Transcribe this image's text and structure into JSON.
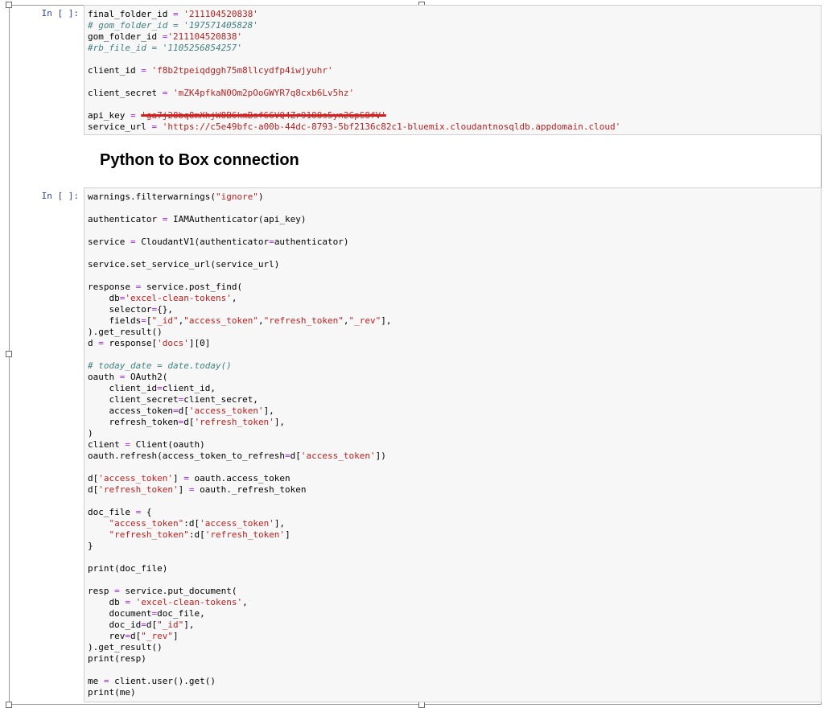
{
  "cells": [
    {
      "prompt": "In [ ]:",
      "lines": [
        [
          [
            "final_folder_id ",
            ""
          ],
          [
            "=",
            "o"
          ],
          [
            " ",
            ""
          ],
          [
            "'211104520838'",
            "s"
          ]
        ],
        [
          [
            "# gom_folder_id = '197571405828'",
            "c"
          ]
        ],
        [
          [
            "gom_folder_id ",
            ""
          ],
          [
            "=",
            "o"
          ],
          [
            "'211104520838'",
            "s"
          ]
        ],
        [
          [
            "#rb_file_id = '1105256854257'",
            "c"
          ]
        ],
        [],
        [
          [
            "client_id ",
            ""
          ],
          [
            "=",
            "o"
          ],
          [
            " ",
            ""
          ],
          [
            "'f8b2tpeiqdggh75m8llcydfp4iwjyuhr'",
            "s"
          ]
        ],
        [],
        [
          [
            "client_secret ",
            ""
          ],
          [
            "=",
            "o"
          ],
          [
            " ",
            ""
          ],
          [
            "'mZK4pfkaN0Om2pOoGWYR7q8cxb6Lv5hz'",
            "s"
          ]
        ],
        [],
        [
          [
            "api_key ",
            ""
          ],
          [
            "=",
            "o"
          ],
          [
            " ",
            ""
          ],
          [
            "'ga7j28bq8mXhjW8B6kmBsf66VQ4Zr9188s5yn2GpS8fV'",
            "red"
          ]
        ],
        [
          [
            "service_url ",
            ""
          ],
          [
            "=",
            "o"
          ],
          [
            " ",
            ""
          ],
          [
            "'https://c5e49bfc-a00b-44dc-8793-5bf2136c82c1-bluemix.cloudantnosqldb.appdomain.cloud'",
            "s"
          ]
        ]
      ]
    },
    {
      "prompt": "In [ ]:",
      "lines": [
        [
          [
            "warnings.filterwarnings(",
            ""
          ],
          [
            "\"ignore\"",
            "s"
          ],
          [
            ")",
            ""
          ]
        ],
        [],
        [
          [
            "authenticator ",
            ""
          ],
          [
            "=",
            "o"
          ],
          [
            " IAMAuthenticator(api_key)",
            ""
          ]
        ],
        [],
        [
          [
            "service ",
            ""
          ],
          [
            "=",
            "o"
          ],
          [
            " CloudantV1(authenticator",
            ""
          ],
          [
            "=",
            "o"
          ],
          [
            "authenticator)",
            ""
          ]
        ],
        [],
        [
          [
            "service.set_service_url(service_url)",
            ""
          ]
        ],
        [],
        [
          [
            "response ",
            ""
          ],
          [
            "=",
            "o"
          ],
          [
            " service.post_find(",
            ""
          ]
        ],
        [
          [
            "    db",
            ""
          ],
          [
            "=",
            "o"
          ],
          [
            "'excel-clean-tokens'",
            "s"
          ],
          [
            ",",
            ""
          ]
        ],
        [
          [
            "    selector",
            ""
          ],
          [
            "=",
            "o"
          ],
          [
            "{},",
            ""
          ]
        ],
        [
          [
            "    fields",
            ""
          ],
          [
            "=",
            "o"
          ],
          [
            "[",
            ""
          ],
          [
            "\"_id\"",
            "s"
          ],
          [
            ",",
            ""
          ],
          [
            "\"access_token\"",
            "s"
          ],
          [
            ",",
            ""
          ],
          [
            "\"refresh_token\"",
            "s"
          ],
          [
            ",",
            ""
          ],
          [
            "\"_rev\"",
            "s"
          ],
          [
            "],",
            ""
          ]
        ],
        [
          [
            ").get_result()",
            ""
          ]
        ],
        [
          [
            "d ",
            ""
          ],
          [
            "=",
            "o"
          ],
          [
            " response[",
            ""
          ],
          [
            "'docs'",
            "s"
          ],
          [
            "][0]",
            ""
          ]
        ],
        [],
        [
          [
            "# today_date = date.today()",
            "c"
          ]
        ],
        [
          [
            "oauth ",
            ""
          ],
          [
            "=",
            "o"
          ],
          [
            " OAuth2(",
            ""
          ]
        ],
        [
          [
            "    client_id",
            ""
          ],
          [
            "=",
            "o"
          ],
          [
            "client_id,",
            ""
          ]
        ],
        [
          [
            "    client_secret",
            ""
          ],
          [
            "=",
            "o"
          ],
          [
            "client_secret,",
            ""
          ]
        ],
        [
          [
            "    access_token",
            ""
          ],
          [
            "=",
            "o"
          ],
          [
            "d[",
            ""
          ],
          [
            "'access_token'",
            "s"
          ],
          [
            "],",
            ""
          ]
        ],
        [
          [
            "    refresh_token",
            ""
          ],
          [
            "=",
            "o"
          ],
          [
            "d[",
            ""
          ],
          [
            "'refresh_token'",
            "s"
          ],
          [
            "],",
            ""
          ]
        ],
        [
          [
            ")",
            ""
          ]
        ],
        [
          [
            "client ",
            ""
          ],
          [
            "=",
            "o"
          ],
          [
            " Client(oauth)",
            ""
          ]
        ],
        [
          [
            "oauth.refresh(access_token_to_refresh",
            ""
          ],
          [
            "=",
            "o"
          ],
          [
            "d[",
            ""
          ],
          [
            "'access_token'",
            "s"
          ],
          [
            "])",
            ""
          ]
        ],
        [],
        [
          [
            "d[",
            ""
          ],
          [
            "'access_token'",
            "s"
          ],
          [
            "] ",
            ""
          ],
          [
            "=",
            "o"
          ],
          [
            " oauth.access_token",
            ""
          ]
        ],
        [
          [
            "d[",
            ""
          ],
          [
            "'refresh_token'",
            "s"
          ],
          [
            "] ",
            ""
          ],
          [
            "=",
            "o"
          ],
          [
            " oauth._refresh_token",
            ""
          ]
        ],
        [],
        [
          [
            "doc_file ",
            ""
          ],
          [
            "=",
            "o"
          ],
          [
            " {",
            ""
          ]
        ],
        [
          [
            "    ",
            ""
          ],
          [
            "\"access_token\"",
            "s"
          ],
          [
            ":d[",
            ""
          ],
          [
            "'access_token'",
            "s"
          ],
          [
            "],",
            ""
          ]
        ],
        [
          [
            "    ",
            ""
          ],
          [
            "\"refresh_token\"",
            "s"
          ],
          [
            ":d[",
            ""
          ],
          [
            "'refresh_token'",
            "s"
          ],
          [
            "]",
            ""
          ]
        ],
        [
          [
            "}",
            ""
          ]
        ],
        [],
        [
          [
            "print(doc_file)",
            ""
          ]
        ],
        [],
        [
          [
            "resp ",
            ""
          ],
          [
            "=",
            "o"
          ],
          [
            " service.put_document(",
            ""
          ]
        ],
        [
          [
            "    db ",
            ""
          ],
          [
            "=",
            "o"
          ],
          [
            " ",
            ""
          ],
          [
            "'excel-clean-tokens'",
            "s"
          ],
          [
            ",",
            ""
          ]
        ],
        [
          [
            "    document",
            ""
          ],
          [
            "=",
            "o"
          ],
          [
            "doc_file,",
            ""
          ]
        ],
        [
          [
            "    doc_id",
            ""
          ],
          [
            "=",
            "o"
          ],
          [
            "d[",
            ""
          ],
          [
            "\"_id\"",
            "s"
          ],
          [
            "],",
            ""
          ]
        ],
        [
          [
            "    rev",
            ""
          ],
          [
            "=",
            "o"
          ],
          [
            "d[",
            ""
          ],
          [
            "\"_rev\"",
            "s"
          ],
          [
            "]",
            ""
          ]
        ],
        [
          [
            ").get_result()",
            ""
          ]
        ],
        [
          [
            "print(resp)",
            ""
          ]
        ],
        [],
        [
          [
            "me ",
            ""
          ],
          [
            "=",
            "o"
          ],
          [
            " client.user().get()",
            ""
          ]
        ],
        [
          [
            "print(me)",
            ""
          ]
        ]
      ]
    }
  ],
  "markdown": {
    "heading": "Python to Box connection"
  }
}
